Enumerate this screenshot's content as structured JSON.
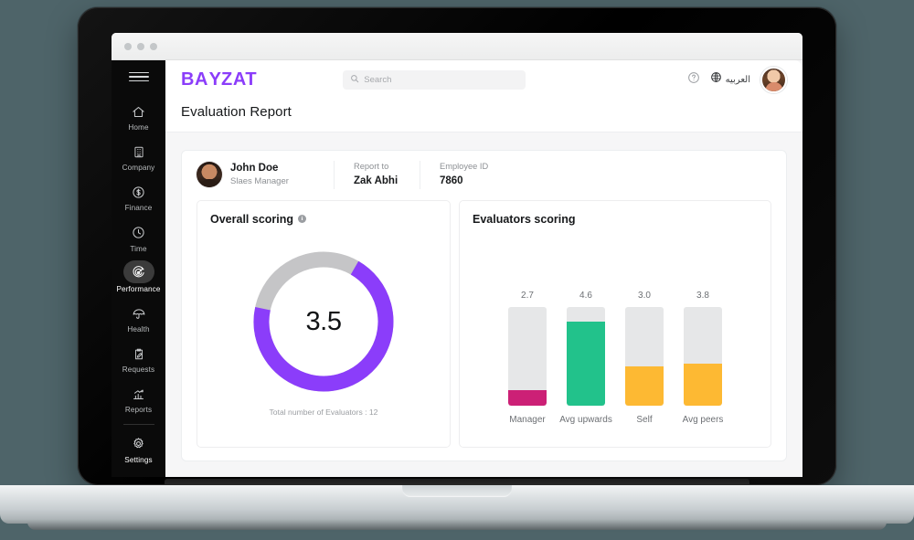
{
  "browser": {
    "dots": 3
  },
  "sidebar": {
    "menu_icon": "hamburger-icon",
    "items": [
      {
        "label": "Home",
        "icon": "home-icon",
        "active": false
      },
      {
        "label": "Company",
        "icon": "building-icon",
        "active": false
      },
      {
        "label": "Finance",
        "icon": "dollar-circle-icon",
        "active": false
      },
      {
        "label": "Time",
        "icon": "clock-icon",
        "active": false
      },
      {
        "label": "Performance",
        "icon": "target-icon",
        "active": true
      },
      {
        "label": "Health",
        "icon": "umbrella-icon",
        "active": false
      },
      {
        "label": "Requests",
        "icon": "clipboard-edit-icon",
        "active": false
      },
      {
        "label": "Reports",
        "icon": "bar-chart-icon",
        "active": false
      }
    ],
    "footer_items": [
      {
        "label": "Settings",
        "icon": "gear-icon",
        "active": false
      }
    ]
  },
  "header": {
    "brand": {
      "before": "BA",
      "y": "Y",
      "after": "ZAT",
      "color": "#8b3dfa"
    },
    "search": {
      "placeholder": "Search",
      "value": "",
      "icon": "search-icon"
    },
    "help_icon": "question-circle-icon",
    "language": {
      "icon": "globe-icon",
      "label": "العربيه"
    },
    "avatar": "user-avatar",
    "page_title": "Evaluation Report"
  },
  "profile": {
    "avatar": "employee-avatar",
    "name": "John Doe",
    "role": "Slaes Manager",
    "fields": [
      {
        "label": "Report to",
        "value": "Zak Abhi"
      },
      {
        "label": "Employee ID",
        "value": "7860"
      }
    ]
  },
  "overall": {
    "title": "Overall scoring",
    "info_icon": "info-icon",
    "info_glyph": "i",
    "caption": "Total number of Evaluators : 12"
  },
  "evaluators": {
    "title": "Evaluators scoring"
  },
  "chart_data": [
    {
      "type": "pie",
      "title": "Overall scoring",
      "subtitle": "Total number of Evaluators : 12",
      "center_label": "3.5",
      "value": 3.5,
      "max": 5,
      "percent": 70,
      "start_angle_deg": 30,
      "sweep_deg": 252,
      "slices": [
        {
          "name": "score",
          "value": 3.5,
          "color": "#8b3dfa"
        },
        {
          "name": "remaining",
          "value": 1.5,
          "color": "#c5c5c7"
        }
      ]
    },
    {
      "type": "bar",
      "title": "Evaluators scoring",
      "categories": [
        "Manager",
        "Avg upwards",
        "Self",
        "Avg peers"
      ],
      "values": [
        2.7,
        4.6,
        3.0,
        3.8
      ],
      "value_labels": [
        "2.7",
        "4.6",
        "3.0",
        "3.8"
      ],
      "colors": [
        "#cc2076",
        "#22c28b",
        "#fdb933",
        "#fdb933"
      ],
      "fill_percents": [
        16,
        85,
        40,
        43
      ],
      "track_color": "#e6e7e8",
      "ylim": [
        0,
        5
      ],
      "xlabel": "",
      "ylabel": "",
      "grid": false,
      "legend": "none"
    }
  ]
}
